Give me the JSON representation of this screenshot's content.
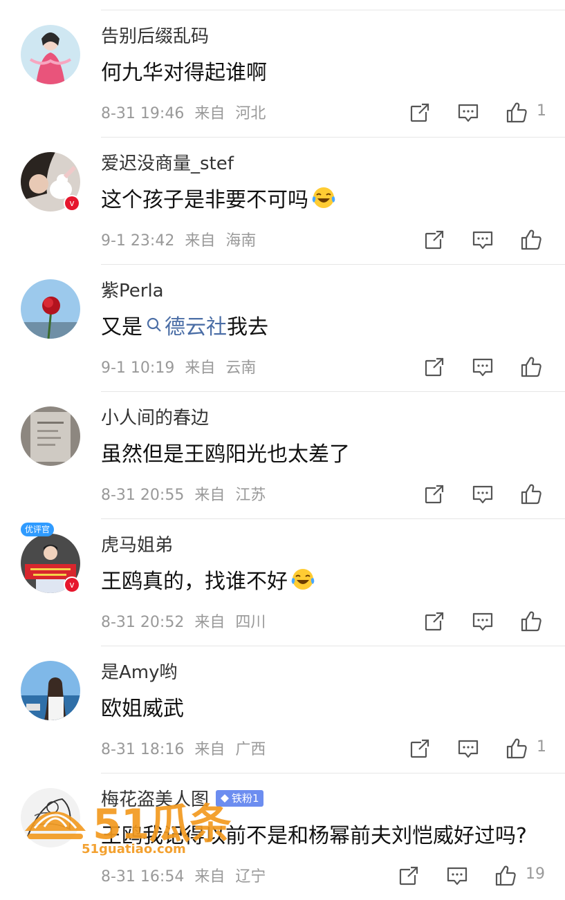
{
  "comments": [
    {
      "username": "告别后缀乱码",
      "text": "何九华对得起谁啊",
      "date": "8-31 19:46",
      "from_label": "来自",
      "location": "河北",
      "likes": "1"
    },
    {
      "username": "爱迟没商量_stef",
      "text": "这个孩子是非要不可吗",
      "date": "9-1 23:42",
      "from_label": "来自",
      "location": "海南",
      "likes": "",
      "verified": "v"
    },
    {
      "username": "紫Perla",
      "text_before": "又是",
      "link_text": "德云社",
      "text_after": "我去",
      "date": "9-1 10:19",
      "from_label": "来自",
      "location": "云南",
      "likes": ""
    },
    {
      "username": "小人间的春边",
      "text": "虽然但是王鸥阳光也太差了",
      "date": "8-31 20:55",
      "from_label": "来自",
      "location": "江苏",
      "likes": ""
    },
    {
      "username": "虎马姐弟",
      "text": "王鸥真的，找谁不好",
      "date": "8-31 20:52",
      "from_label": "来自",
      "location": "四川",
      "likes": "",
      "top_tag": "优评官",
      "verified": "v"
    },
    {
      "username": "是Amy哟",
      "text": "欧姐威武",
      "date": "8-31 18:16",
      "from_label": "来自",
      "location": "广西",
      "likes": "1"
    },
    {
      "username": "梅花盗美人图",
      "fan_badge": "铁粉1",
      "text": "王鸥我记得以前不是和杨幂前夫刘恺威好过吗?",
      "date": "8-31 16:54",
      "from_label": "来自",
      "location": "辽宁",
      "likes": "19"
    }
  ],
  "watermark": {
    "brand": "51瓜条",
    "url": "51guatiao.com"
  },
  "icons": {
    "repost": "repost-icon",
    "comment": "comment-icon",
    "like": "like-icon",
    "laugh_cry": "laugh-cry-emoji-icon",
    "search": "search-icon",
    "diamond": "diamond-icon"
  },
  "colors": {
    "link": "#4b6ea6",
    "meta": "#999999",
    "verified": "#e6162d",
    "fan_badge": "#6c8df0",
    "watermark": "#f39a1f"
  }
}
